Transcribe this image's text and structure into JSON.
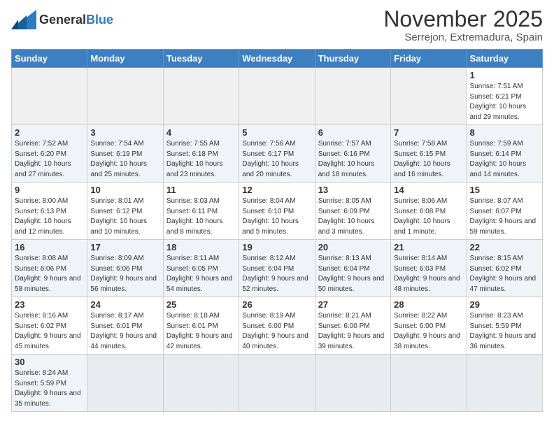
{
  "header": {
    "logo_general": "General",
    "logo_blue": "Blue",
    "month": "November 2025",
    "location": "Serrejon, Extremadura, Spain"
  },
  "days_of_week": [
    "Sunday",
    "Monday",
    "Tuesday",
    "Wednesday",
    "Thursday",
    "Friday",
    "Saturday"
  ],
  "weeks": [
    {
      "days": [
        {
          "num": "",
          "info": ""
        },
        {
          "num": "",
          "info": ""
        },
        {
          "num": "",
          "info": ""
        },
        {
          "num": "",
          "info": ""
        },
        {
          "num": "",
          "info": ""
        },
        {
          "num": "",
          "info": ""
        },
        {
          "num": "1",
          "info": "Sunrise: 7:51 AM\nSunset: 6:21 PM\nDaylight: 10 hours and 29 minutes."
        }
      ]
    },
    {
      "days": [
        {
          "num": "2",
          "info": "Sunrise: 7:52 AM\nSunset: 6:20 PM\nDaylight: 10 hours and 27 minutes."
        },
        {
          "num": "3",
          "info": "Sunrise: 7:54 AM\nSunset: 6:19 PM\nDaylight: 10 hours and 25 minutes."
        },
        {
          "num": "4",
          "info": "Sunrise: 7:55 AM\nSunset: 6:18 PM\nDaylight: 10 hours and 23 minutes."
        },
        {
          "num": "5",
          "info": "Sunrise: 7:56 AM\nSunset: 6:17 PM\nDaylight: 10 hours and 20 minutes."
        },
        {
          "num": "6",
          "info": "Sunrise: 7:57 AM\nSunset: 6:16 PM\nDaylight: 10 hours and 18 minutes."
        },
        {
          "num": "7",
          "info": "Sunrise: 7:58 AM\nSunset: 6:15 PM\nDaylight: 10 hours and 16 minutes."
        },
        {
          "num": "8",
          "info": "Sunrise: 7:59 AM\nSunset: 6:14 PM\nDaylight: 10 hours and 14 minutes."
        }
      ]
    },
    {
      "days": [
        {
          "num": "9",
          "info": "Sunrise: 8:00 AM\nSunset: 6:13 PM\nDaylight: 10 hours and 12 minutes."
        },
        {
          "num": "10",
          "info": "Sunrise: 8:01 AM\nSunset: 6:12 PM\nDaylight: 10 hours and 10 minutes."
        },
        {
          "num": "11",
          "info": "Sunrise: 8:03 AM\nSunset: 6:11 PM\nDaylight: 10 hours and 8 minutes."
        },
        {
          "num": "12",
          "info": "Sunrise: 8:04 AM\nSunset: 6:10 PM\nDaylight: 10 hours and 5 minutes."
        },
        {
          "num": "13",
          "info": "Sunrise: 8:05 AM\nSunset: 6:09 PM\nDaylight: 10 hours and 3 minutes."
        },
        {
          "num": "14",
          "info": "Sunrise: 8:06 AM\nSunset: 6:08 PM\nDaylight: 10 hours and 1 minute."
        },
        {
          "num": "15",
          "info": "Sunrise: 8:07 AM\nSunset: 6:07 PM\nDaylight: 9 hours and 59 minutes."
        }
      ]
    },
    {
      "days": [
        {
          "num": "16",
          "info": "Sunrise: 8:08 AM\nSunset: 6:06 PM\nDaylight: 9 hours and 58 minutes."
        },
        {
          "num": "17",
          "info": "Sunrise: 8:09 AM\nSunset: 6:06 PM\nDaylight: 9 hours and 56 minutes."
        },
        {
          "num": "18",
          "info": "Sunrise: 8:11 AM\nSunset: 6:05 PM\nDaylight: 9 hours and 54 minutes."
        },
        {
          "num": "19",
          "info": "Sunrise: 8:12 AM\nSunset: 6:04 PM\nDaylight: 9 hours and 52 minutes."
        },
        {
          "num": "20",
          "info": "Sunrise: 8:13 AM\nSunset: 6:04 PM\nDaylight: 9 hours and 50 minutes."
        },
        {
          "num": "21",
          "info": "Sunrise: 8:14 AM\nSunset: 6:03 PM\nDaylight: 9 hours and 48 minutes."
        },
        {
          "num": "22",
          "info": "Sunrise: 8:15 AM\nSunset: 6:02 PM\nDaylight: 9 hours and 47 minutes."
        }
      ]
    },
    {
      "days": [
        {
          "num": "23",
          "info": "Sunrise: 8:16 AM\nSunset: 6:02 PM\nDaylight: 9 hours and 45 minutes."
        },
        {
          "num": "24",
          "info": "Sunrise: 8:17 AM\nSunset: 6:01 PM\nDaylight: 9 hours and 44 minutes."
        },
        {
          "num": "25",
          "info": "Sunrise: 8:18 AM\nSunset: 6:01 PM\nDaylight: 9 hours and 42 minutes."
        },
        {
          "num": "26",
          "info": "Sunrise: 8:19 AM\nSunset: 6:00 PM\nDaylight: 9 hours and 40 minutes."
        },
        {
          "num": "27",
          "info": "Sunrise: 8:21 AM\nSunset: 6:00 PM\nDaylight: 9 hours and 39 minutes."
        },
        {
          "num": "28",
          "info": "Sunrise: 8:22 AM\nSunset: 6:00 PM\nDaylight: 9 hours and 38 minutes."
        },
        {
          "num": "29",
          "info": "Sunrise: 8:23 AM\nSunset: 5:59 PM\nDaylight: 9 hours and 36 minutes."
        }
      ]
    },
    {
      "days": [
        {
          "num": "30",
          "info": "Sunrise: 8:24 AM\nSunset: 5:59 PM\nDaylight: 9 hours and 35 minutes."
        },
        {
          "num": "",
          "info": ""
        },
        {
          "num": "",
          "info": ""
        },
        {
          "num": "",
          "info": ""
        },
        {
          "num": "",
          "info": ""
        },
        {
          "num": "",
          "info": ""
        },
        {
          "num": "",
          "info": ""
        }
      ]
    }
  ]
}
